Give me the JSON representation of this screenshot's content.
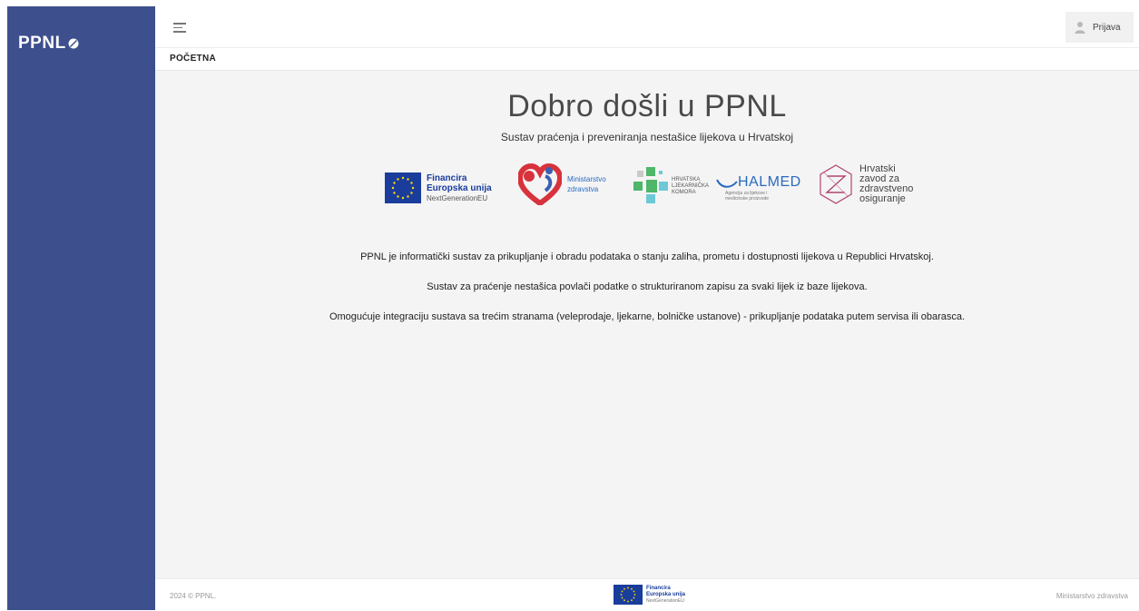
{
  "brand": {
    "name": "PPNL"
  },
  "header": {
    "login_label": "Prijava"
  },
  "breadcrumb": {
    "current": "POČETNA"
  },
  "hero": {
    "title": "Dobro došli u PPNL",
    "subtitle": "Sustav praćenja i preveniranja nestašice lijekova u Hrvatskoj"
  },
  "logos": {
    "eu": {
      "line1": "Financira",
      "line2": "Europska unija",
      "line3": "NextGenerationEU"
    },
    "ministry": {
      "line1": "Ministarstvo",
      "line2": "zdravstva"
    },
    "hljk": {
      "line1": "HRVATSKA",
      "line2": "LJEKARNIČKA",
      "line3": "KOMORA"
    },
    "halmed": {
      "name": "HALMED",
      "tagline1": "Agencija za lijekove i",
      "tagline2": "medicinske proizvode"
    },
    "hzzo": {
      "line1": "Hrvatski",
      "line2": "zavod za",
      "line3": "zdravstveno",
      "line4": "osiguranje"
    }
  },
  "paragraphs": [
    "PPNL je informatički sustav za prikupljanje i obradu podataka o stanju zaliha, prometu i dostupnosti lijekova u Republici Hrvatskoj.",
    "Sustav za praćenje nestašica povlači podatke o strukturiranom zapisu za svaki lijek iz baze lijekova.",
    "Omogućuje integraciju sustava sa trećim stranama (veleprodaje, ljekarne, bolničke ustanove) - prikupljanje podataka putem servisa ili obarasca."
  ],
  "footer": {
    "copyright": "2024 © PPNL.",
    "eu_line1": "Financira",
    "eu_line2": "Europska unija",
    "eu_line3": "NextGenerationEU",
    "right": "Ministarstvo zdravstva"
  },
  "colors": {
    "sidebar": "#3d4f8c",
    "eu_blue": "#1a3d9c",
    "eu_yellow": "#ffdd00",
    "ministry_red": "#d8323c",
    "hljk_green": "#4fb66a",
    "halmed_blue": "#2a6bbf",
    "hzzo_pink": "#b0436f"
  }
}
